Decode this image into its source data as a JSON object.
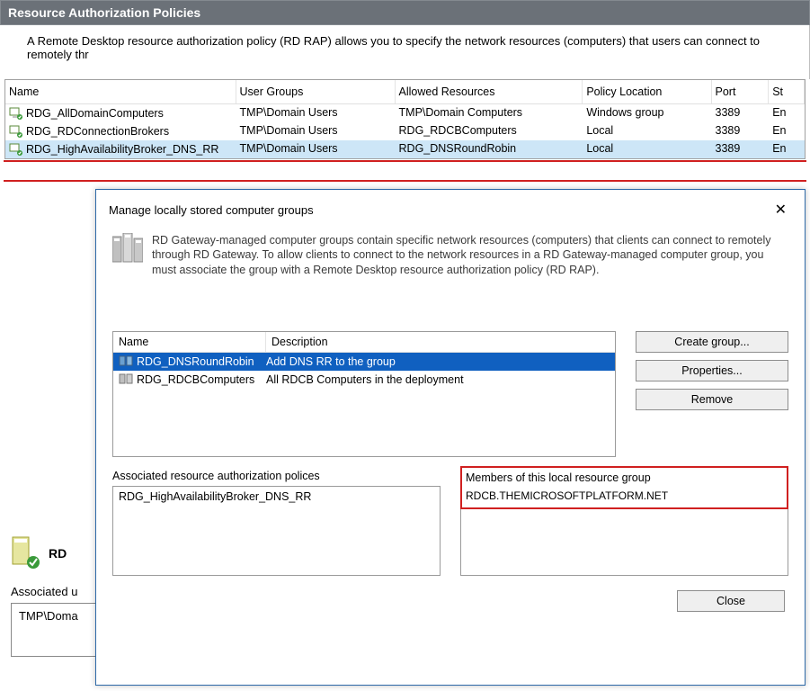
{
  "panel": {
    "title": "Resource Authorization Policies",
    "intro": "A Remote Desktop resource authorization policy (RD RAP) allows you to specify the network resources (computers) that users can connect to remotely thr"
  },
  "policy_table": {
    "headers": {
      "name": "Name",
      "user_groups": "User Groups",
      "allowed": "Allowed Resources",
      "location": "Policy Location",
      "port": "Port",
      "status": "St"
    },
    "rows": [
      {
        "name": "RDG_AllDomainComputers",
        "user_groups": "TMP\\Domain Users",
        "allowed": "TMP\\Domain Computers",
        "location": "Windows group",
        "port": "3389",
        "status": "En"
      },
      {
        "name": "RDG_RDConnectionBrokers",
        "user_groups": "TMP\\Domain Users",
        "allowed": "RDG_RDCBComputers",
        "location": "Local",
        "port": "3389",
        "status": "En"
      },
      {
        "name": "RDG_HighAvailabilityBroker_DNS_RR",
        "user_groups": "TMP\\Domain Users",
        "allowed": "RDG_DNSRoundRobin",
        "location": "Local",
        "port": "3389",
        "status": "En"
      }
    ]
  },
  "dialog": {
    "title": "Manage locally stored computer groups",
    "info": "RD Gateway-managed computer groups contain specific network resources (computers) that clients can connect to remotely through RD Gateway. To allow clients to connect to the network resources in a RD Gateway-managed computer group, you must associate the group with a Remote Desktop resource authorization policy (RD RAP).",
    "list_headers": {
      "name": "Name",
      "desc": "Description"
    },
    "groups": [
      {
        "name": "RDG_DNSRoundRobin",
        "desc": "Add DNS RR to the group"
      },
      {
        "name": "RDG_RDCBComputers",
        "desc": "All RDCB Computers in the deployment"
      }
    ],
    "buttons": {
      "create": "Create group...",
      "properties": "Properties...",
      "remove": "Remove",
      "close": "Close"
    },
    "assoc_label": "Associated resource authorization polices",
    "assoc_value": "RDG_HighAvailabilityBroker_DNS_RR",
    "members_label": "Members of this local resource group",
    "members_value": "RDCB.THEMICROSOFTPLATFORM.NET"
  },
  "background": {
    "rd_label": "RD",
    "assoc_label": "Associated u",
    "assoc_box_value": "TMP\\Doma"
  }
}
